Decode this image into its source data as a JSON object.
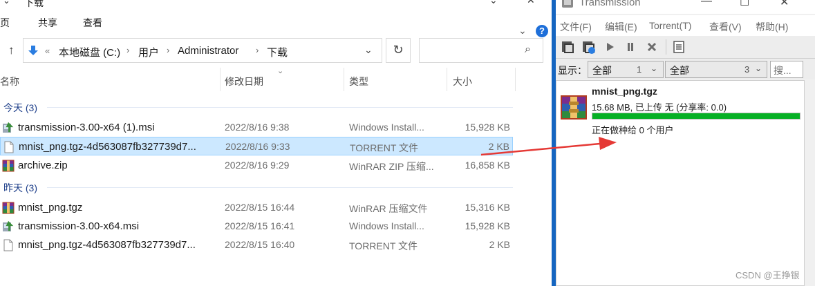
{
  "explorer": {
    "window_title": "下载",
    "ribbon_tabs": [
      "主页",
      "共享",
      "查看"
    ],
    "path": [
      "本地磁盘 (C:)",
      "用户",
      "Administrator",
      "下载"
    ],
    "path_prefix": "«",
    "search_placeholder": "",
    "columns": [
      "名称",
      "修改日期",
      "类型",
      "大小"
    ],
    "groups": [
      {
        "label": "今天 (3)",
        "files": [
          {
            "name": "transmission-3.00-x64 (1).msi",
            "date": "2022/8/16 9:38",
            "type": "Windows Install...",
            "size": "15,928 KB",
            "icon": "msi-installer-icon",
            "selected": false
          },
          {
            "name": "mnist_png.tgz-4d563087fb327739d7...",
            "date": "2022/8/16 9:33",
            "type": "TORRENT 文件",
            "size": "2 KB",
            "icon": "torrent-file-icon",
            "selected": true
          },
          {
            "name": "archive.zip",
            "date": "2022/8/16 9:29",
            "type": "WinRAR ZIP 压缩...",
            "size": "16,858 KB",
            "icon": "winrar-archive-icon",
            "selected": false
          }
        ]
      },
      {
        "label": "昨天 (3)",
        "files": [
          {
            "name": "mnist_png.tgz",
            "date": "2022/8/15 16:44",
            "type": "WinRAR 压缩文件",
            "size": "15,316 KB",
            "icon": "winrar-archive-icon",
            "selected": false
          },
          {
            "name": "transmission-3.00-x64.msi",
            "date": "2022/8/15 16:41",
            "type": "Windows Install...",
            "size": "15,928 KB",
            "icon": "msi-installer-icon",
            "selected": false
          },
          {
            "name": "mnist_png.tgz-4d563087fb327739d7...",
            "date": "2022/8/15 16:40",
            "type": "TORRENT 文件",
            "size": "2 KB",
            "icon": "torrent-file-icon",
            "selected": false
          }
        ]
      }
    ]
  },
  "transmission": {
    "title": "Transmission",
    "menu": [
      "文件(F)",
      "编辑(E)",
      "Torrent(T)",
      "查看(V)",
      "帮助(H)"
    ],
    "toolbar_icons": [
      "open-torrent-icon",
      "open-url-icon",
      "start-icon",
      "pause-icon",
      "remove-icon",
      "properties-icon"
    ],
    "filter": {
      "label": "显示：",
      "status_value": "全部",
      "status_count": "1",
      "tracker_value": "全部",
      "tracker_count": "3",
      "search_text": "搜..."
    },
    "torrent": {
      "name": "mnist_png.tgz",
      "info": "15.68 MB, 已上传 无 (分享率: 0.0)",
      "progress": 1.0,
      "status": "正在做种给 0 个用户"
    }
  },
  "watermark": "CSDN @王挣银",
  "colors": {
    "selection": "#cce8ff",
    "progress_green": "#06b025",
    "divider_blue": "#1565c0",
    "arrow_red": "#e53935"
  }
}
